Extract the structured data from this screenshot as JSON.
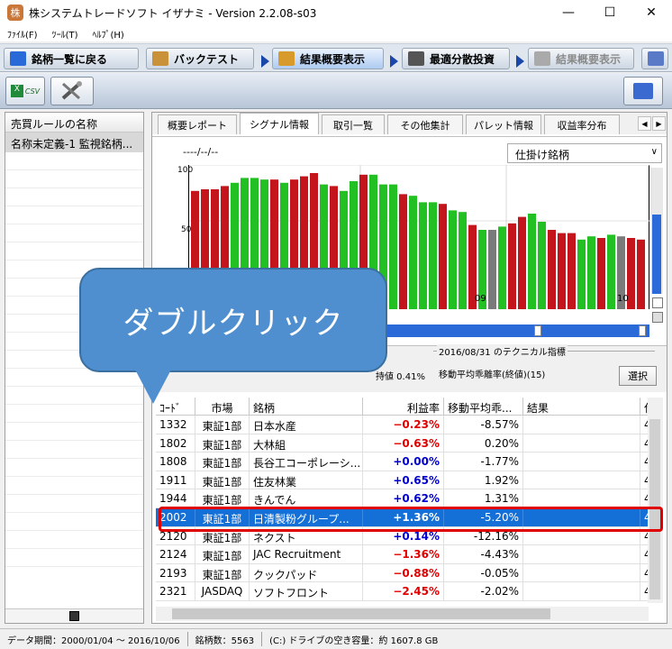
{
  "window": {
    "title": "株システムトレードソフト イザナミ - Version 2.2.08-s03",
    "minimize": "—",
    "maximize": "☐",
    "close": "✕"
  },
  "menu": [
    "ﾌｧｲﾙ(F)",
    "ﾂｰﾙ(T)",
    "ﾍﾙﾌﾟ(H)"
  ],
  "nav": {
    "back": "銘柄一覧に戻る",
    "backtest": "バックテスト",
    "result_summary": "結果概要表示",
    "optimal_invest": "最適分散投資",
    "result_summary2": "結果概要表示"
  },
  "toolbar": {
    "csv_label": "CSV"
  },
  "left_panel": {
    "header": "売買ルールの名称",
    "selected_item": "名称未定義-1 監視銘柄..."
  },
  "tabs": [
    "概要レポート",
    "シグナル情報",
    "取引一覧",
    "その他集計",
    "パレット情報",
    "収益率分布"
  ],
  "chart": {
    "date_label": "----/--/--",
    "dropdown_value": "仕掛け銘柄",
    "y_ticks": [
      "100",
      "50"
    ],
    "x_ticks": [
      "09",
      "10"
    ]
  },
  "chart_data": {
    "type": "bar",
    "ylim": [
      0,
      100
    ],
    "values": [
      84,
      85,
      85,
      87,
      89,
      92,
      92,
      91,
      91,
      89,
      91,
      93,
      95,
      88,
      87,
      84,
      90,
      94,
      94,
      88,
      88,
      82,
      81,
      77,
      77,
      76,
      72,
      71,
      63,
      60,
      60,
      62,
      64,
      68,
      70,
      65,
      60,
      58,
      58,
      54,
      56,
      55,
      57,
      56,
      55,
      54
    ],
    "colors": [
      "red",
      "red",
      "red",
      "red",
      "green",
      "green",
      "green",
      "green",
      "red",
      "green",
      "red",
      "red",
      "red",
      "green",
      "red",
      "green",
      "green",
      "red",
      "green",
      "green",
      "green",
      "red",
      "green",
      "green",
      "green",
      "red",
      "green",
      "green",
      "red",
      "green",
      "gray",
      "green",
      "red",
      "red",
      "green",
      "green",
      "red",
      "red",
      "red",
      "green",
      "green",
      "red",
      "green",
      "gray",
      "red",
      "red"
    ]
  },
  "tech": {
    "title": "2016/08/31 のテクニカル指標",
    "indicator": "移動平均乖離率(終値)(15)",
    "partial_left": "持値 0.41%",
    "select_button": "選択"
  },
  "table": {
    "headers": [
      "ｺｰﾄﾞ",
      "市場",
      "銘柄",
      "利益率",
      "移動平均乖...",
      "結果",
      "仕"
    ],
    "rows": [
      {
        "code": "1332",
        "market": "東証1部",
        "name": "日本水産",
        "profit": "−0.23%",
        "sign": "neg",
        "ma": "-8.57%",
        "result": "",
        "extra": "4"
      },
      {
        "code": "1802",
        "market": "東証1部",
        "name": "大林組",
        "profit": "−0.63%",
        "sign": "neg",
        "ma": "0.20%",
        "result": "",
        "extra": "4"
      },
      {
        "code": "1808",
        "market": "東証1部",
        "name": "長谷工コーポレーシ...",
        "profit": "+0.00%",
        "sign": "pos",
        "ma": "-1.77%",
        "result": "",
        "extra": "4"
      },
      {
        "code": "1911",
        "market": "東証1部",
        "name": "住友林業",
        "profit": "+0.65%",
        "sign": "pos",
        "ma": "1.92%",
        "result": "",
        "extra": "4"
      },
      {
        "code": "1944",
        "market": "東証1部",
        "name": "きんでん",
        "profit": "+0.62%",
        "sign": "pos",
        "ma": "1.31%",
        "result": "",
        "extra": "4"
      },
      {
        "code": "2002",
        "market": "東証1部",
        "name": "日清製粉グループ...",
        "profit": "+1.36%",
        "sign": "pos",
        "ma": "-5.20%",
        "result": "",
        "extra": "4",
        "selected": true
      },
      {
        "code": "2120",
        "market": "東証1部",
        "name": "ネクスト",
        "profit": "+0.14%",
        "sign": "pos",
        "ma": "-12.16%",
        "result": "",
        "extra": "4"
      },
      {
        "code": "2124",
        "market": "東証1部",
        "name": "JAC Recruitment",
        "profit": "−1.36%",
        "sign": "neg",
        "ma": "-4.43%",
        "result": "",
        "extra": "4"
      },
      {
        "code": "2193",
        "market": "東証1部",
        "name": "クックパッド",
        "profit": "−0.88%",
        "sign": "neg",
        "ma": "-0.05%",
        "result": "",
        "extra": "4"
      },
      {
        "code": "2321",
        "market": "JASDAQ",
        "name": "ソフトフロント",
        "profit": "−2.45%",
        "sign": "neg",
        "ma": "-2.02%",
        "result": "",
        "extra": "4"
      }
    ]
  },
  "callout": {
    "text": "ダブルクリック"
  },
  "status": {
    "period": "データ期間：2000/01/04 〜 2016/10/06",
    "count": "銘柄数：5563",
    "drive": "(C:) ドライブの空き容量：約 1607.8 GB"
  }
}
